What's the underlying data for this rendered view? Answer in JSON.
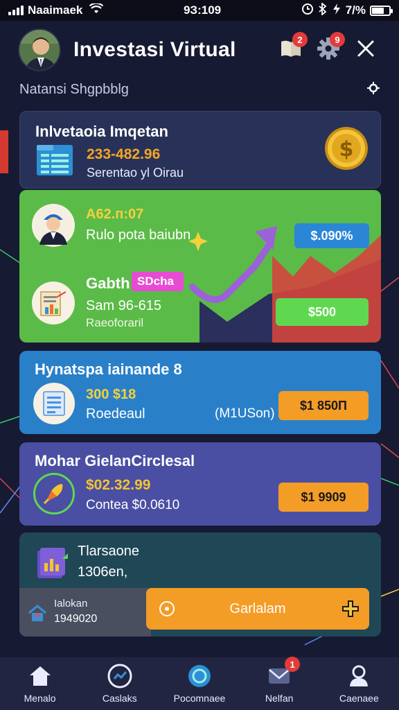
{
  "status_bar": {
    "carrier": "Naaimaek",
    "time": "9З:109",
    "battery": "7/%"
  },
  "header": {
    "title": "Investasi Virtual",
    "notif_badge": "2",
    "settings_badge": "9"
  },
  "subheader": {
    "text": "Natansi Shgpbblg"
  },
  "card_main": {
    "title": "Inlvetaoia Imqetan",
    "value": "233-482.96",
    "caption": "Serentao yl Oirau"
  },
  "card_green": {
    "top_value": "A62.п:07",
    "top_text": "Rulo pota baiubn",
    "percent_pill": "$.090%",
    "mid_label": "Gabth",
    "tag": "SDcha",
    "mid_value": "Sam 96-615",
    "mid_caption": "Raeoforaril",
    "price_pill": "$500"
  },
  "card_blue": {
    "title": "Hynatspa iainande 8",
    "value": "300 $18",
    "caption": "Roedeaul",
    "aside": "(M1USon)",
    "button": "$1  850П"
  },
  "card_purple": {
    "title": "Mohar GielanCirclesal",
    "value": "$02.32.99",
    "caption": "Contea $0.0610",
    "button": "$1  9909"
  },
  "card_teal": {
    "title": "Tlarsaone",
    "subtitle": "1306en,",
    "side_label": "Ialokan",
    "side_value": "1949020",
    "action_button": "Garlalam"
  },
  "bottom_nav": [
    {
      "label": "Menalo"
    },
    {
      "label": "Caslaks"
    },
    {
      "label": "Pocomnaee"
    },
    {
      "label": "Nelfan",
      "badge": "1"
    },
    {
      "label": "Caenaee"
    }
  ],
  "colors": {
    "background": "#171a33",
    "accent_orange": "#f39c26",
    "accent_green": "#5bbb48",
    "accent_blue": "#2980c9",
    "accent_purple": "#4a4fa3",
    "badge_red": "#e23b3b"
  }
}
